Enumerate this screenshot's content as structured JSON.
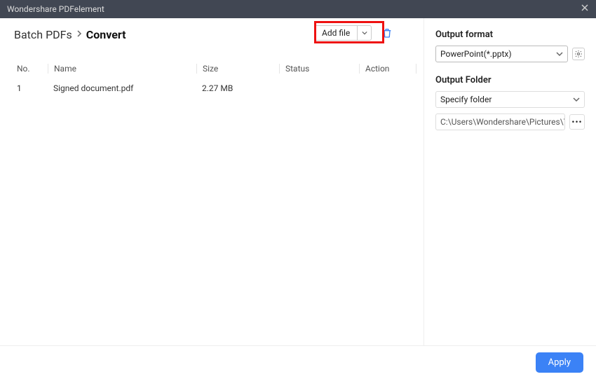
{
  "app_title": "Wondershare PDFelement",
  "breadcrumb": {
    "root": "Batch PDFs",
    "current": "Convert"
  },
  "toolbar": {
    "add_file_label": "Add file"
  },
  "columns": {
    "no": "No.",
    "name": "Name",
    "size": "Size",
    "status": "Status",
    "action": "Action"
  },
  "rows": [
    {
      "no": "1",
      "name": "Signed document.pdf",
      "size": "2.27 MB",
      "status": "",
      "action": ""
    }
  ],
  "right": {
    "output_format_label": "Output format",
    "output_format_value": "PowerPoint(*.pptx)",
    "output_folder_label": "Output Folder",
    "output_folder_value": "Specify folder",
    "path_value": "C:\\Users\\Wondershare\\Pictures\\TLDR T"
  },
  "footer": {
    "apply_label": "Apply"
  }
}
